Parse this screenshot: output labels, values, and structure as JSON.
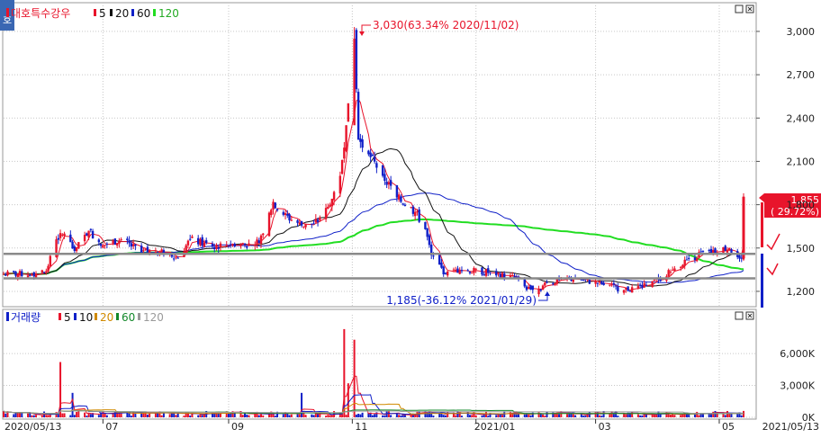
{
  "header": {
    "price_badge": "호",
    "title": "대호특수강우",
    "ma_legend": [
      {
        "label": "5",
        "color": "#e8142b"
      },
      {
        "label": "20",
        "color": "#111111"
      },
      {
        "label": "60",
        "color": "#1020c8"
      },
      {
        "label": "120",
        "color": "#22dd22"
      }
    ]
  },
  "volume_header": {
    "title": "거래량",
    "ma_legend": [
      {
        "label": "5",
        "color": "#e8142b"
      },
      {
        "label": "10",
        "color": "#1020c8"
      },
      {
        "label": "20",
        "color": "#d08a00"
      },
      {
        "label": "60",
        "color": "#12882a"
      },
      {
        "label": "120",
        "color": "#9a9a9a"
      }
    ]
  },
  "annotations": {
    "high": "3,030(63.34% 2020/11/02)",
    "low": "1,185(-36.12% 2021/01/29)"
  },
  "current_price": {
    "price": "1,855",
    "change": "( 29.72%)"
  },
  "x_axis": {
    "start": "2020/05/13",
    "end": "2021/05/13",
    "months": [
      "07",
      "09",
      "11",
      "2021/01",
      "03",
      "05"
    ]
  },
  "colors": {
    "up": "#e8142b",
    "down": "#1020c8",
    "ma5": "#e8142b",
    "ma20": "#111111",
    "ma60": "#1020c8",
    "ma120": "#22dd22",
    "ref_line": "#8a8a8a",
    "grid": "#c7c7c7"
  },
  "chart_data": [
    {
      "type": "candlestick",
      "title": "대호특수강우",
      "y_ticks": [
        "3,000",
        "2,700",
        "2,400",
        "2,100",
        "1,800",
        "1,500",
        "1,200"
      ],
      "ylim": [
        1100,
        3180
      ],
      "x_range": [
        "2020/05/13",
        "2021/05/13"
      ],
      "series_close": [
        [
          "2020/05/13",
          1320
        ],
        [
          "2020/05/27",
          1320
        ],
        [
          "2020/06/03",
          1340
        ],
        [
          "2020/06/08",
          1560
        ],
        [
          "2020/06/12",
          1600
        ],
        [
          "2020/06/17",
          1480
        ],
        [
          "2020/06/24",
          1620
        ],
        [
          "2020/07/01",
          1520
        ],
        [
          "2020/07/10",
          1560
        ],
        [
          "2020/07/20",
          1470
        ],
        [
          "2020/07/30",
          1490
        ],
        [
          "2020/08/07",
          1430
        ],
        [
          "2020/08/13",
          1560
        ],
        [
          "2020/08/24",
          1510
        ],
        [
          "2020/09/03",
          1530
        ],
        [
          "2020/09/14",
          1520
        ],
        [
          "2020/09/18",
          1600
        ],
        [
          "2020/09/23",
          1820
        ],
        [
          "2020/09/28",
          1730
        ],
        [
          "2020/10/08",
          1650
        ],
        [
          "2020/10/15",
          1680
        ],
        [
          "2020/10/21",
          1800
        ],
        [
          "2020/10/26",
          2000
        ],
        [
          "2020/10/29",
          2350
        ],
        [
          "2020/11/02",
          3030
        ],
        [
          "2020/11/03",
          2600
        ],
        [
          "2020/11/04",
          2250
        ],
        [
          "2020/11/09",
          2150
        ],
        [
          "2020/11/16",
          2000
        ],
        [
          "2020/11/23",
          1850
        ],
        [
          "2020/12/02",
          1750
        ],
        [
          "2020/12/07",
          1630
        ],
        [
          "2020/12/10",
          1450
        ],
        [
          "2020/12/17",
          1320
        ],
        [
          "2020/12/24",
          1350
        ],
        [
          "2021/01/08",
          1330
        ],
        [
          "2021/01/21",
          1290
        ],
        [
          "2021/01/29",
          1185
        ],
        [
          "2021/02/05",
          1260
        ],
        [
          "2021/02/19",
          1290
        ],
        [
          "2021/03/04",
          1250
        ],
        [
          "2021/03/15",
          1210
        ],
        [
          "2021/03/26",
          1240
        ],
        [
          "2021/04/01",
          1280
        ],
        [
          "2021/04/08",
          1350
        ],
        [
          "2021/04/15",
          1420
        ],
        [
          "2021/04/26",
          1480
        ],
        [
          "2021/05/06",
          1500
        ],
        [
          "2021/05/12",
          1430
        ],
        [
          "2021/05/13",
          1855
        ]
      ],
      "reference_lines": [
        1460,
        1290
      ],
      "annotated_high": {
        "value": 3030,
        "date": "2020/11/02"
      },
      "annotated_low": {
        "value": 1185,
        "date": "2021/01/29"
      }
    },
    {
      "type": "bar",
      "title": "거래량",
      "y_ticks": [
        "6,000K",
        "3,000K",
        "0K"
      ],
      "ylim": [
        0,
        8800
      ],
      "spikes_K": [
        [
          "2020/06/10",
          5200
        ],
        [
          "2020/06/16",
          2300
        ],
        [
          "2020/10/07",
          2300
        ],
        [
          "2020/10/28",
          8300
        ],
        [
          "2020/10/30",
          3200
        ],
        [
          "2020/11/02",
          7300
        ],
        [
          "2021/05/13",
          600
        ]
      ]
    }
  ]
}
